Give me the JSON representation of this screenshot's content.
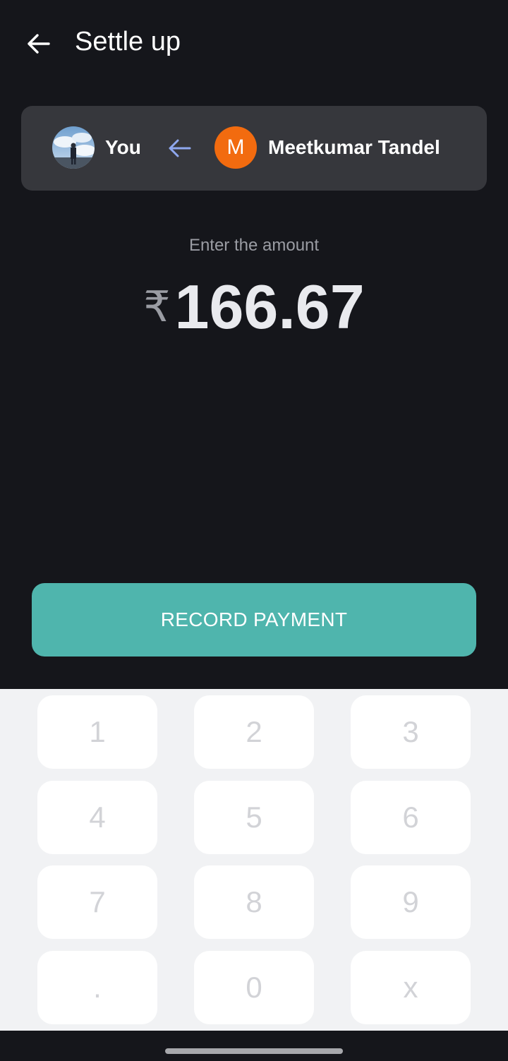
{
  "header": {
    "title": "Settle up",
    "back_icon": "arrow-left-icon"
  },
  "parties": {
    "payer_name": "You",
    "direction_icon": "arrow-left-icon",
    "payee_initial": "M",
    "payee_name": "Meetkumar Tandel",
    "payee_avatar_color": "#f26b0f"
  },
  "amount": {
    "prompt": "Enter the amount",
    "currency_symbol": "₹",
    "value": "166.67"
  },
  "actions": {
    "record_label": "RECORD PAYMENT",
    "record_color": "#4fb5ad"
  },
  "keypad": {
    "keys": [
      "1",
      "2",
      "3",
      "4",
      "5",
      "6",
      "7",
      "8",
      "9",
      ".",
      "0",
      "x"
    ]
  }
}
